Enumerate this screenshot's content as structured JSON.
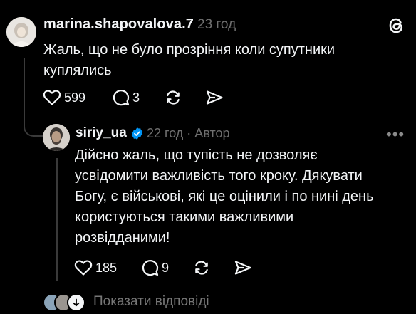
{
  "post": {
    "username": "marina.shapovalova.7",
    "time": "23 год",
    "text": "Жаль, що не було прозріння коли супутники куплялись",
    "likes": "599",
    "comments": "3"
  },
  "reply": {
    "username": "siriy_ua",
    "time_author": "22 год · Автор",
    "text": "Дійсно жаль, що тупість не дозволяє усвідомити важливість того кроку. Дякувати Богу, є військові, які це оцінили і по нині день користуються такими важливими розвідданими!",
    "likes": "185",
    "comments": "9",
    "verified": true
  },
  "show_replies": "Показати відповіді",
  "icons": {
    "logo": "threads-logo-icon",
    "like": "heart-icon",
    "comment": "comment-bubble-icon",
    "repost": "repost-icon",
    "share": "send-icon",
    "more": "more-dots-icon"
  },
  "colors": {
    "background": "#000000",
    "text": "#f3f5f7",
    "muted": "#6f6f6f",
    "verified": "#0095f6"
  }
}
